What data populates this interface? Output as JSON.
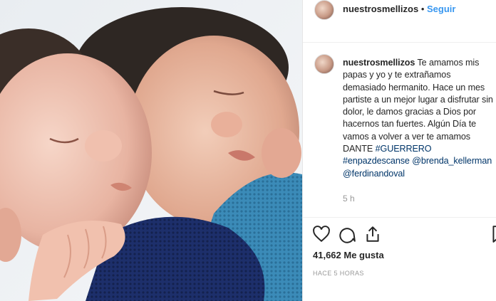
{
  "post": {
    "username": "nuestrosmellizos",
    "separator": "•",
    "follow_label": "Seguir",
    "caption_user": "nuestrosmellizos",
    "caption_text": "Te amamos mis papas y yo y te extrañamos demasiado hermanito. Hace un mes partiste a un mejor lugar a disfrutar sin dolor, le damos gracias a Dios por hacernos tan fuertes. Algún Día te vamos a volver a ver te amamos DANTE",
    "hashtag_1": "#GUERRERO",
    "hashtag_2": "#enpazdescanse",
    "mention_1": "@brenda_kellerman",
    "mention_2": "@ferdinandoval",
    "caption_time": "5 h",
    "likes": "41,662 Me gusta",
    "posted_ago": "HACE 5 HORAS"
  },
  "icons": [
    "heart-icon",
    "comment-icon",
    "share-icon",
    "bookmark-icon"
  ],
  "colors": {
    "link": "#3897f0",
    "tag": "#003569",
    "muted": "#999999"
  }
}
